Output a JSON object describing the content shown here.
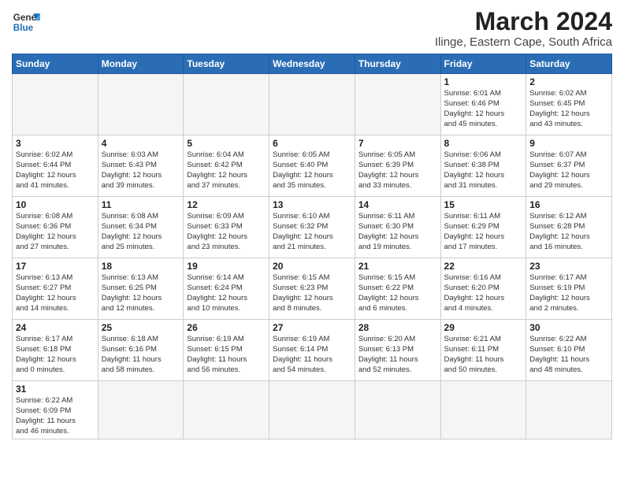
{
  "header": {
    "logo_general": "General",
    "logo_blue": "Blue",
    "title": "March 2024",
    "subtitle": "Ilinge, Eastern Cape, South Africa"
  },
  "days_of_week": [
    "Sunday",
    "Monday",
    "Tuesday",
    "Wednesday",
    "Thursday",
    "Friday",
    "Saturday"
  ],
  "weeks": [
    [
      {
        "day": "",
        "info": "",
        "empty": true
      },
      {
        "day": "",
        "info": "",
        "empty": true
      },
      {
        "day": "",
        "info": "",
        "empty": true
      },
      {
        "day": "",
        "info": "",
        "empty": true
      },
      {
        "day": "",
        "info": "",
        "empty": true
      },
      {
        "day": "1",
        "info": "Sunrise: 6:01 AM\nSunset: 6:46 PM\nDaylight: 12 hours\nand 45 minutes."
      },
      {
        "day": "2",
        "info": "Sunrise: 6:02 AM\nSunset: 6:45 PM\nDaylight: 12 hours\nand 43 minutes."
      }
    ],
    [
      {
        "day": "3",
        "info": "Sunrise: 6:02 AM\nSunset: 6:44 PM\nDaylight: 12 hours\nand 41 minutes."
      },
      {
        "day": "4",
        "info": "Sunrise: 6:03 AM\nSunset: 6:43 PM\nDaylight: 12 hours\nand 39 minutes."
      },
      {
        "day": "5",
        "info": "Sunrise: 6:04 AM\nSunset: 6:42 PM\nDaylight: 12 hours\nand 37 minutes."
      },
      {
        "day": "6",
        "info": "Sunrise: 6:05 AM\nSunset: 6:40 PM\nDaylight: 12 hours\nand 35 minutes."
      },
      {
        "day": "7",
        "info": "Sunrise: 6:05 AM\nSunset: 6:39 PM\nDaylight: 12 hours\nand 33 minutes."
      },
      {
        "day": "8",
        "info": "Sunrise: 6:06 AM\nSunset: 6:38 PM\nDaylight: 12 hours\nand 31 minutes."
      },
      {
        "day": "9",
        "info": "Sunrise: 6:07 AM\nSunset: 6:37 PM\nDaylight: 12 hours\nand 29 minutes."
      }
    ],
    [
      {
        "day": "10",
        "info": "Sunrise: 6:08 AM\nSunset: 6:36 PM\nDaylight: 12 hours\nand 27 minutes."
      },
      {
        "day": "11",
        "info": "Sunrise: 6:08 AM\nSunset: 6:34 PM\nDaylight: 12 hours\nand 25 minutes."
      },
      {
        "day": "12",
        "info": "Sunrise: 6:09 AM\nSunset: 6:33 PM\nDaylight: 12 hours\nand 23 minutes."
      },
      {
        "day": "13",
        "info": "Sunrise: 6:10 AM\nSunset: 6:32 PM\nDaylight: 12 hours\nand 21 minutes."
      },
      {
        "day": "14",
        "info": "Sunrise: 6:11 AM\nSunset: 6:30 PM\nDaylight: 12 hours\nand 19 minutes."
      },
      {
        "day": "15",
        "info": "Sunrise: 6:11 AM\nSunset: 6:29 PM\nDaylight: 12 hours\nand 17 minutes."
      },
      {
        "day": "16",
        "info": "Sunrise: 6:12 AM\nSunset: 6:28 PM\nDaylight: 12 hours\nand 16 minutes."
      }
    ],
    [
      {
        "day": "17",
        "info": "Sunrise: 6:13 AM\nSunset: 6:27 PM\nDaylight: 12 hours\nand 14 minutes."
      },
      {
        "day": "18",
        "info": "Sunrise: 6:13 AM\nSunset: 6:25 PM\nDaylight: 12 hours\nand 12 minutes."
      },
      {
        "day": "19",
        "info": "Sunrise: 6:14 AM\nSunset: 6:24 PM\nDaylight: 12 hours\nand 10 minutes."
      },
      {
        "day": "20",
        "info": "Sunrise: 6:15 AM\nSunset: 6:23 PM\nDaylight: 12 hours\nand 8 minutes."
      },
      {
        "day": "21",
        "info": "Sunrise: 6:15 AM\nSunset: 6:22 PM\nDaylight: 12 hours\nand 6 minutes."
      },
      {
        "day": "22",
        "info": "Sunrise: 6:16 AM\nSunset: 6:20 PM\nDaylight: 12 hours\nand 4 minutes."
      },
      {
        "day": "23",
        "info": "Sunrise: 6:17 AM\nSunset: 6:19 PM\nDaylight: 12 hours\nand 2 minutes."
      }
    ],
    [
      {
        "day": "24",
        "info": "Sunrise: 6:17 AM\nSunset: 6:18 PM\nDaylight: 12 hours\nand 0 minutes."
      },
      {
        "day": "25",
        "info": "Sunrise: 6:18 AM\nSunset: 6:16 PM\nDaylight: 11 hours\nand 58 minutes."
      },
      {
        "day": "26",
        "info": "Sunrise: 6:19 AM\nSunset: 6:15 PM\nDaylight: 11 hours\nand 56 minutes."
      },
      {
        "day": "27",
        "info": "Sunrise: 6:19 AM\nSunset: 6:14 PM\nDaylight: 11 hours\nand 54 minutes."
      },
      {
        "day": "28",
        "info": "Sunrise: 6:20 AM\nSunset: 6:13 PM\nDaylight: 11 hours\nand 52 minutes."
      },
      {
        "day": "29",
        "info": "Sunrise: 6:21 AM\nSunset: 6:11 PM\nDaylight: 11 hours\nand 50 minutes."
      },
      {
        "day": "30",
        "info": "Sunrise: 6:22 AM\nSunset: 6:10 PM\nDaylight: 11 hours\nand 48 minutes."
      }
    ],
    [
      {
        "day": "31",
        "info": "Sunrise: 6:22 AM\nSunset: 6:09 PM\nDaylight: 11 hours\nand 46 minutes.",
        "last": true
      },
      {
        "day": "",
        "info": "",
        "empty": true,
        "last": true
      },
      {
        "day": "",
        "info": "",
        "empty": true,
        "last": true
      },
      {
        "day": "",
        "info": "",
        "empty": true,
        "last": true
      },
      {
        "day": "",
        "info": "",
        "empty": true,
        "last": true
      },
      {
        "day": "",
        "info": "",
        "empty": true,
        "last": true
      },
      {
        "day": "",
        "info": "",
        "empty": true,
        "last": true
      }
    ]
  ]
}
